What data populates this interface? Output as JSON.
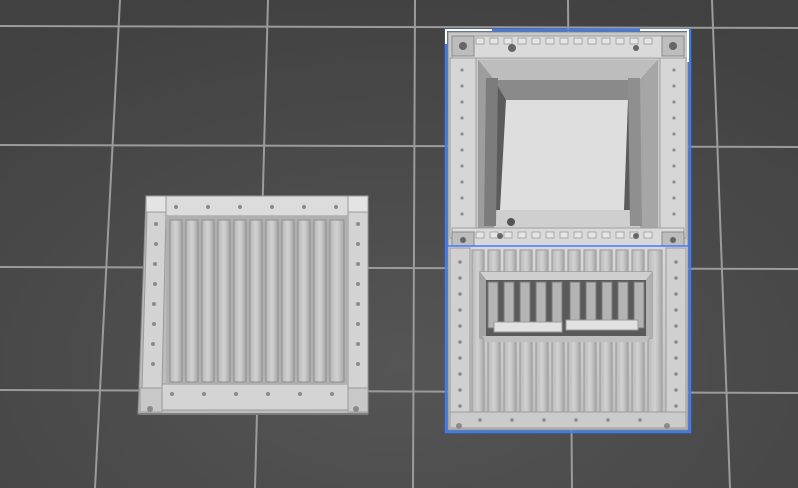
{
  "viewport": {
    "background": "#4a4a4a",
    "grid_color": "#9a9a9a",
    "selection_color": "#3d7bff"
  },
  "objects": [
    {
      "name": "crate-lid",
      "selected": false
    },
    {
      "name": "crate-body",
      "selected": true
    }
  ],
  "icons": [
    "selection-corner-icon"
  ]
}
